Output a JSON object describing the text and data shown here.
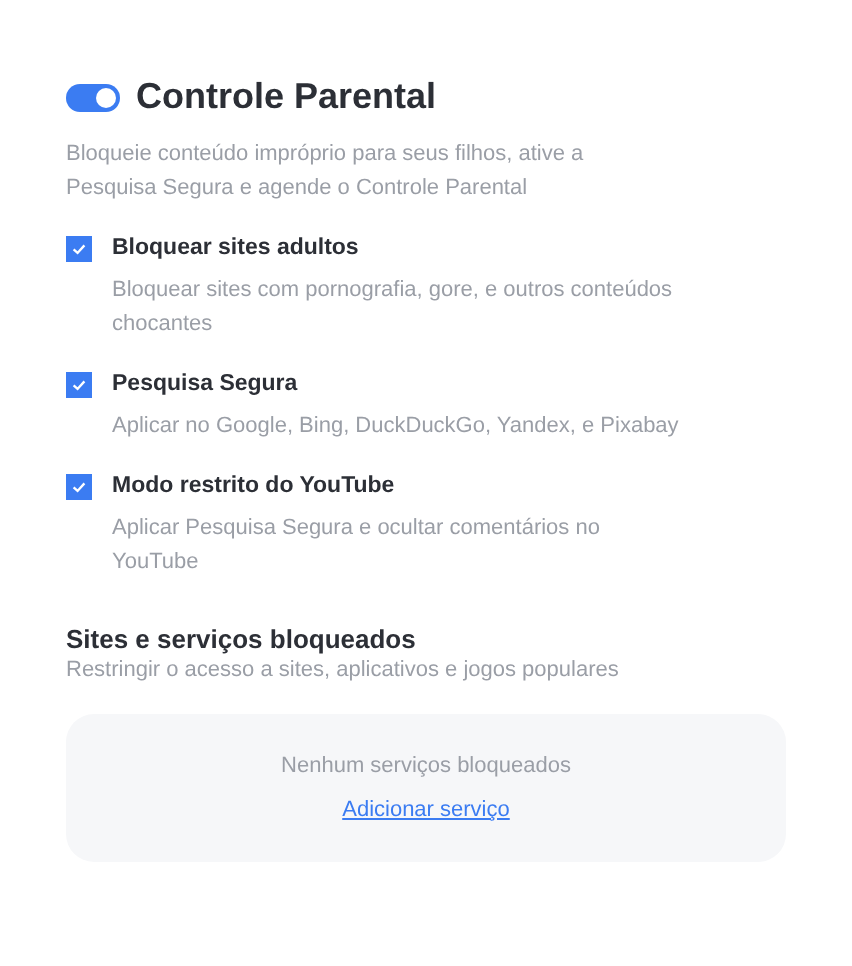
{
  "header": {
    "toggle": {
      "on": true
    },
    "title": "Controle Parental",
    "description": "Bloqueie conteúdo impróprio para seus filhos, ative a Pesquisa Segura e agende o Controle Parental"
  },
  "options": [
    {
      "label": "Bloquear sites adultos",
      "description": "Bloquear sites com pornografia, gore, e outros conteúdos chocantes",
      "checked": true
    },
    {
      "label": "Pesquisa Segura",
      "description": "Aplicar no Google, Bing, DuckDuckGo, Yandex, e Pixabay",
      "checked": true
    },
    {
      "label": "Modo restrito do YouTube",
      "description": "Aplicar Pesquisa Segura e ocultar comentários no YouTube",
      "checked": true
    }
  ],
  "blocked": {
    "title": "Sites e serviços bloqueados",
    "description": "Restringir o acesso a sites, aplicativos e jogos populares",
    "empty_text": "Nenhum serviços bloqueados",
    "add_link": "Adicionar serviço"
  }
}
